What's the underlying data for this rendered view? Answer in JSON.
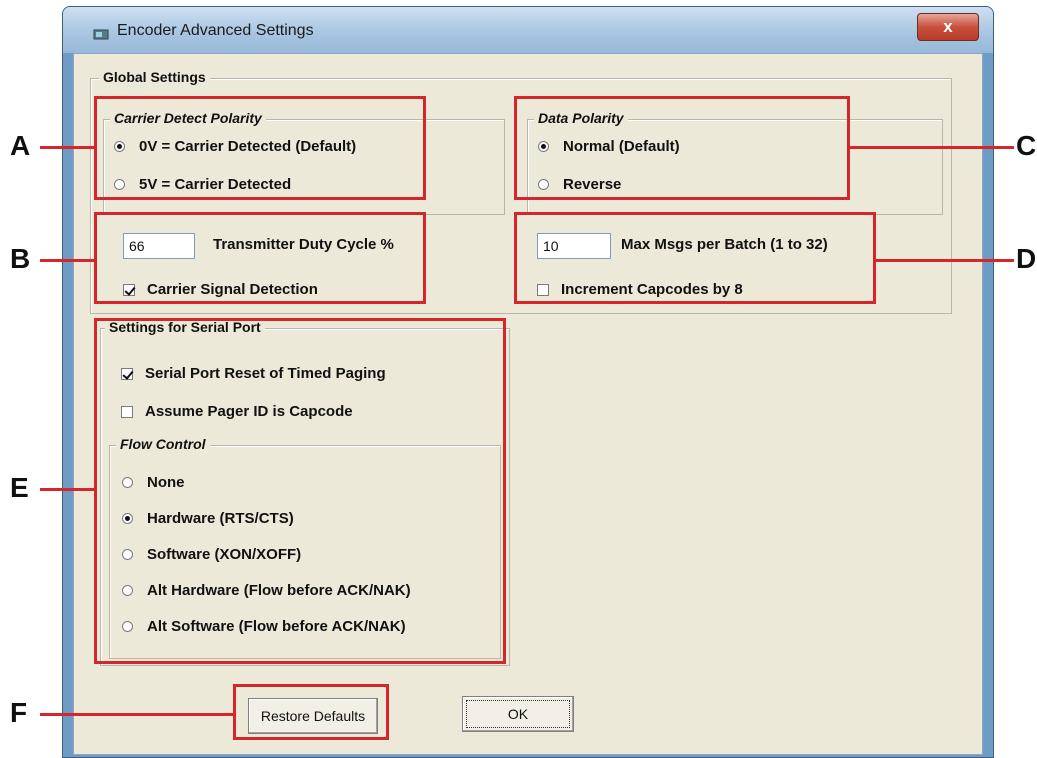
{
  "window": {
    "title": "Encoder Advanced Settings",
    "close_glyph": "x"
  },
  "global": {
    "legend": "Global Settings",
    "carrier_detect": {
      "legend": "Carrier Detect Polarity",
      "opt_0v": "0V = Carrier Detected (Default)",
      "opt_5v": "5V = Carrier Detected",
      "selected": "0V"
    },
    "data_polarity": {
      "legend": "Data Polarity",
      "opt_normal": "Normal (Default)",
      "opt_reverse": "Reverse",
      "selected": "Normal"
    },
    "duty_cycle_value": "66",
    "duty_cycle_label": "Transmitter Duty Cycle %",
    "carrier_signal_label": "Carrier Signal Detection",
    "carrier_signal_checked": true,
    "max_msgs_value": "10",
    "max_msgs_label": "Max Msgs per Batch (1 to 32)",
    "increment_label": "Increment Capcodes by 8",
    "increment_checked": false
  },
  "serial": {
    "legend": "Settings for Serial Port",
    "reset_label": "Serial Port Reset of Timed Paging",
    "reset_checked": true,
    "assume_label": "Assume Pager ID is Capcode",
    "assume_checked": false,
    "flow": {
      "legend": "Flow Control",
      "options": [
        "None",
        "Hardware (RTS/CTS)",
        "Software (XON/XOFF)",
        "Alt Hardware (Flow before ACK/NAK)",
        "Alt Software (Flow before ACK/NAK)"
      ],
      "selected": "Hardware (RTS/CTS)"
    }
  },
  "buttons": {
    "restore": "Restore Defaults",
    "ok": "OK"
  },
  "annotations": {
    "labels": [
      "A",
      "B",
      "C",
      "D",
      "E",
      "F"
    ],
    "color": "#d5262b"
  }
}
